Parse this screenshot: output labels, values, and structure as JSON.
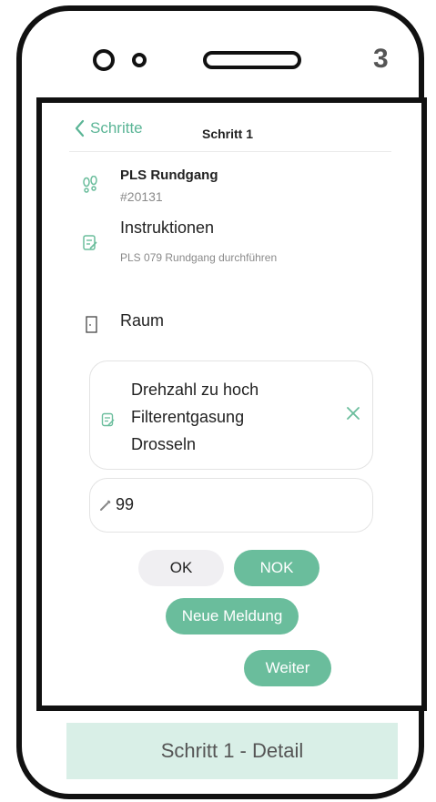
{
  "step_number": "3",
  "header": {
    "back_label": "Schritte",
    "title": "Schritt 1"
  },
  "round": {
    "name": "PLS Rundgang",
    "id": "#20131",
    "icon": "footsteps-icon"
  },
  "instructions": {
    "label": "Instruktionen",
    "text": "PLS 079 Rundgang durchführen",
    "icon": "note-edit-icon"
  },
  "room": {
    "label": "Raum",
    "icon": "door-icon"
  },
  "finding": {
    "lines": [
      "Drehzahl zu hoch",
      "Filterentgasung",
      "Drosseln"
    ],
    "icon": "note-edit-icon",
    "clear_icon": "close-icon"
  },
  "measurement": {
    "value": "99",
    "icon": "pencil-icon"
  },
  "buttons": {
    "ok": "OK",
    "nok": "NOK",
    "new_report": "Neue Meldung",
    "next": "Weiter"
  },
  "caption": "Schritt 1 - Detail",
  "colors": {
    "accent": "#6abd9c",
    "accent_text": "#5bb596",
    "caption_bg": "#d9efe7",
    "ok_bg": "#f0eff2"
  }
}
